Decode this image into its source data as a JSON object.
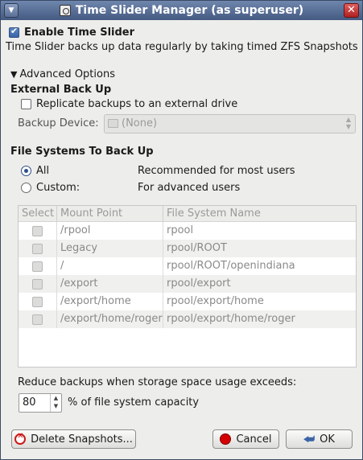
{
  "window": {
    "title": "Time Slider Manager (as superuser)"
  },
  "enable": {
    "label": "Enable Time Slider",
    "checked": true,
    "description": "Time Slider backs up data regularly by taking timed ZFS Snapshots"
  },
  "advanced": {
    "toggle_label": "Advanced Options",
    "toggle_glyph": "▼"
  },
  "external": {
    "heading": "External Back Up",
    "replicate_label": "Replicate backups to an external drive",
    "device_label": "Backup Device:",
    "device_value": "(None)"
  },
  "filesystems": {
    "heading": "File Systems To Back Up",
    "options": [
      {
        "label": "All",
        "hint": "Recommended for most users",
        "selected": true
      },
      {
        "label": "Custom:",
        "hint": "For advanced users",
        "selected": false
      }
    ],
    "columns": [
      "Select",
      "Mount Point",
      "File System Name"
    ],
    "rows": [
      {
        "mount": "/rpool",
        "fs": "rpool"
      },
      {
        "mount": "Legacy",
        "fs": "rpool/ROOT"
      },
      {
        "mount": "/",
        "fs": "rpool/ROOT/openindiana"
      },
      {
        "mount": "/export",
        "fs": "rpool/export"
      },
      {
        "mount": "/export/home",
        "fs": "rpool/export/home"
      },
      {
        "mount": "/export/home/roger",
        "fs": "rpool/export/home/roger"
      }
    ]
  },
  "storage": {
    "label": "Reduce backups when storage space usage exceeds:",
    "value": "80",
    "suffix": "% of file system capacity"
  },
  "buttons": {
    "delete": "Delete Snapshots...",
    "cancel": "Cancel",
    "ok": "OK"
  },
  "colors": {
    "titlebar": "#445a82",
    "accent": "#3b64a6",
    "cancel_icon": "#d40000"
  }
}
